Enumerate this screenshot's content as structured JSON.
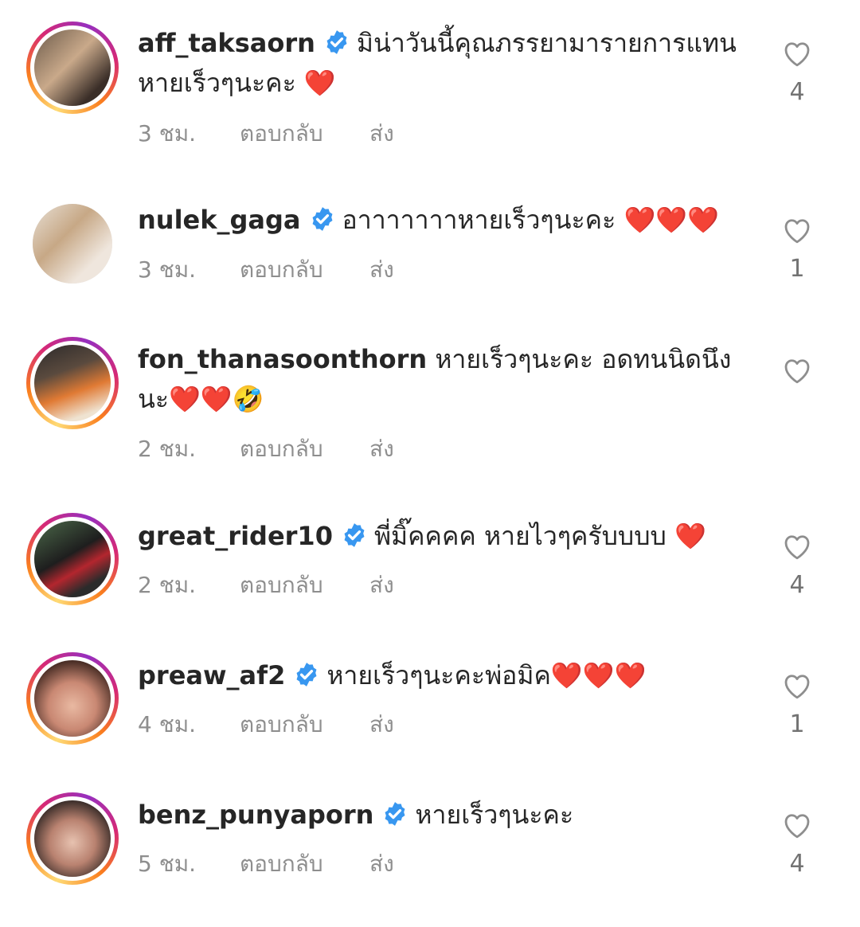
{
  "colors": {
    "verified_badge": "#3897f0",
    "heart": "#ed2b3b",
    "muted_text": "#8e8e8e"
  },
  "icons": {
    "verified": "verified-badge-icon",
    "like": "heart-outline-icon"
  },
  "actions": {
    "reply": "ตอบกลับ",
    "send": "ส่ง"
  },
  "comments": [
    {
      "username": "aff_taksaorn",
      "verified": true,
      "text": "มิน่าวันนี้คุณภรรยามารายการแทน หายเร็วๆนะคะ ",
      "emoji": "❤️",
      "time": "3 ชม.",
      "likes": "4"
    },
    {
      "username": "nulek_gaga",
      "verified": true,
      "text": "อาาาาาาาหายเร็วๆนะคะ ",
      "emoji": "❤️❤️❤️",
      "time": "3 ชม.",
      "likes": "1"
    },
    {
      "username": "fon_thanasoonthorn",
      "verified": false,
      "text": "หายเร็วๆนะคะ อดทนนิดนึงนะ",
      "emoji": "❤️❤️🤣",
      "time": "2 ชม.",
      "likes": ""
    },
    {
      "username": "great_rider10",
      "verified": true,
      "text": "พี่มิ๊คคคค หายไวๆครับบบบ ",
      "emoji": "❤️",
      "time": "2 ชม.",
      "likes": "4"
    },
    {
      "username": "preaw_af2",
      "verified": true,
      "text": "หายเร็วๆนะคะพ่อมิค",
      "emoji": "❤️❤️❤️",
      "time": "4 ชม.",
      "likes": "1"
    },
    {
      "username": "benz_punyaporn",
      "verified": true,
      "text": "หายเร็วๆนะคะ",
      "emoji": "",
      "time": "5 ชม.",
      "likes": "4"
    }
  ]
}
